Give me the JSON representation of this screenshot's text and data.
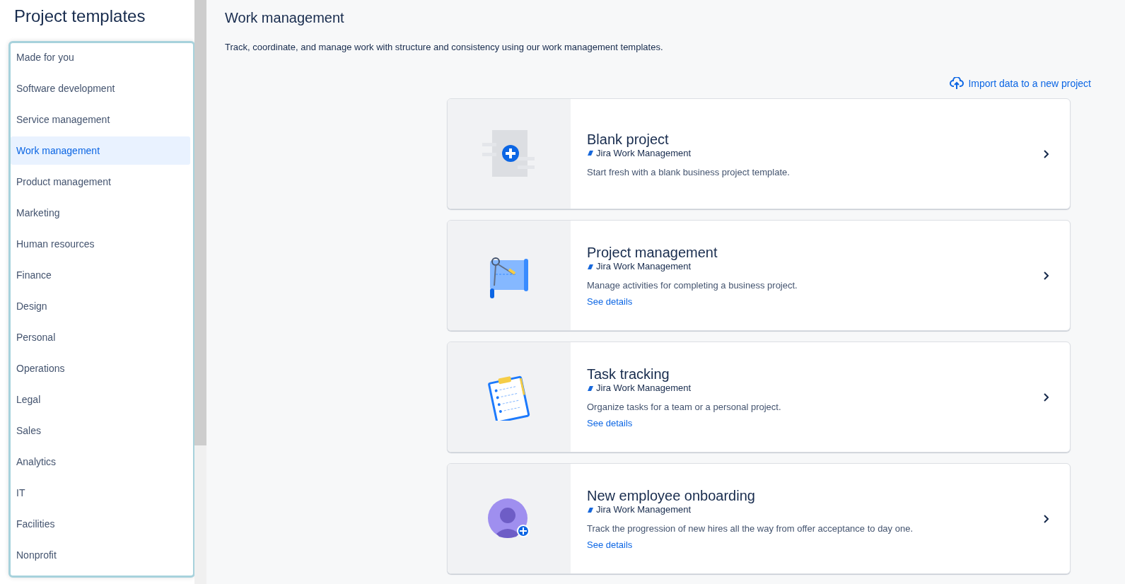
{
  "sidebar": {
    "title": "Project templates",
    "items": [
      {
        "label": "Made for you",
        "selected": false
      },
      {
        "label": "Software development",
        "selected": false
      },
      {
        "label": "Service management",
        "selected": false
      },
      {
        "label": "Work management",
        "selected": true
      },
      {
        "label": "Product management",
        "selected": false
      },
      {
        "label": "Marketing",
        "selected": false
      },
      {
        "label": "Human resources",
        "selected": false
      },
      {
        "label": "Finance",
        "selected": false
      },
      {
        "label": "Design",
        "selected": false
      },
      {
        "label": "Personal",
        "selected": false
      },
      {
        "label": "Operations",
        "selected": false
      },
      {
        "label": "Legal",
        "selected": false
      },
      {
        "label": "Sales",
        "selected": false
      },
      {
        "label": "Analytics",
        "selected": false
      },
      {
        "label": "IT",
        "selected": false
      },
      {
        "label": "Facilities",
        "selected": false
      },
      {
        "label": "Nonprofit",
        "selected": false
      }
    ]
  },
  "main": {
    "title": "Work management",
    "description": "Track, coordinate, and manage work with structure and consistency using our work management templates.",
    "import_link": "Import data to a new project",
    "templates": [
      {
        "kind": "blank",
        "title": "Blank project",
        "product": "Jira Work Management",
        "description": "Start fresh with a blank business project template."
      },
      {
        "kind": "plan",
        "title": "Project management",
        "product": "Jira Work Management",
        "description": "Manage activities for completing a business project.",
        "details_link": "See details"
      },
      {
        "kind": "tasks",
        "title": "Task tracking",
        "product": "Jira Work Management",
        "description": "Organize tasks for a team or a personal project.",
        "details_link": "See details"
      },
      {
        "kind": "person",
        "title": "New employee onboarding",
        "product": "Jira Work Management",
        "description": "Track the progression of new hires all the way from offer acceptance to day one.",
        "details_link": "See details"
      }
    ]
  }
}
